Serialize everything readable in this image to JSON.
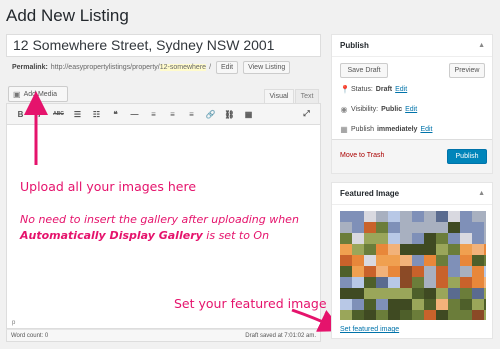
{
  "page": {
    "title": "Add New Listing"
  },
  "post": {
    "title": "12 Somewhere Street, Sydney NSW 2001",
    "permalink_label": "Permalink:",
    "permalink_base": "http://easypropertylistings/property/",
    "permalink_slug": "12-somewhere",
    "permalink_trailing": "/",
    "edit_label": "Edit",
    "view_label": "View Listing"
  },
  "editor": {
    "add_media": "Add Media",
    "tab_visual": "Visual",
    "tab_text": "Text",
    "toolbar": [
      {
        "name": "bold-icon",
        "glyph": "B"
      },
      {
        "name": "italic-icon",
        "glyph": "I"
      },
      {
        "name": "strikethrough-icon",
        "glyph": "ABC"
      },
      {
        "name": "bullet-list-icon",
        "glyph": "☰"
      },
      {
        "name": "numbered-list-icon",
        "glyph": "☷"
      },
      {
        "name": "blockquote-icon",
        "glyph": "❝"
      },
      {
        "name": "horizontal-line-icon",
        "glyph": "—"
      },
      {
        "name": "align-left-icon",
        "glyph": "≡"
      },
      {
        "name": "align-center-icon",
        "glyph": "≡"
      },
      {
        "name": "align-right-icon",
        "glyph": "≡"
      },
      {
        "name": "insert-link-icon",
        "glyph": "🔗"
      },
      {
        "name": "remove-link-icon",
        "glyph": "⛓"
      },
      {
        "name": "toolbar-toggle-icon",
        "glyph": "▦"
      }
    ],
    "fullscreen_glyph": "⤢",
    "path": "p",
    "word_count": "Word count: 0",
    "draft_saved": "Draft saved at 7:01:02 am."
  },
  "annotations": {
    "upload": "Upload all your images here",
    "no_need": "No need to insert the gallery after uploading when",
    "auto_display_bold": "Automatically Display Gallery",
    "auto_display_rest": " is set to On",
    "featured": "Set your featured image",
    "color": "#e5136c"
  },
  "publish": {
    "header": "Publish",
    "save_draft": "Save Draft",
    "preview": "Preview",
    "status_label": "Status:",
    "status_value": "Draft",
    "visibility_label": "Visibility:",
    "visibility_value": "Public",
    "publish_label": "Publish",
    "publish_value": "immediately",
    "edit": "Edit",
    "trash": "Move to Trash",
    "publish_button": "Publish",
    "accent": "#0085ba"
  },
  "featured": {
    "header": "Featured Image",
    "set_link": "Set featured image"
  }
}
